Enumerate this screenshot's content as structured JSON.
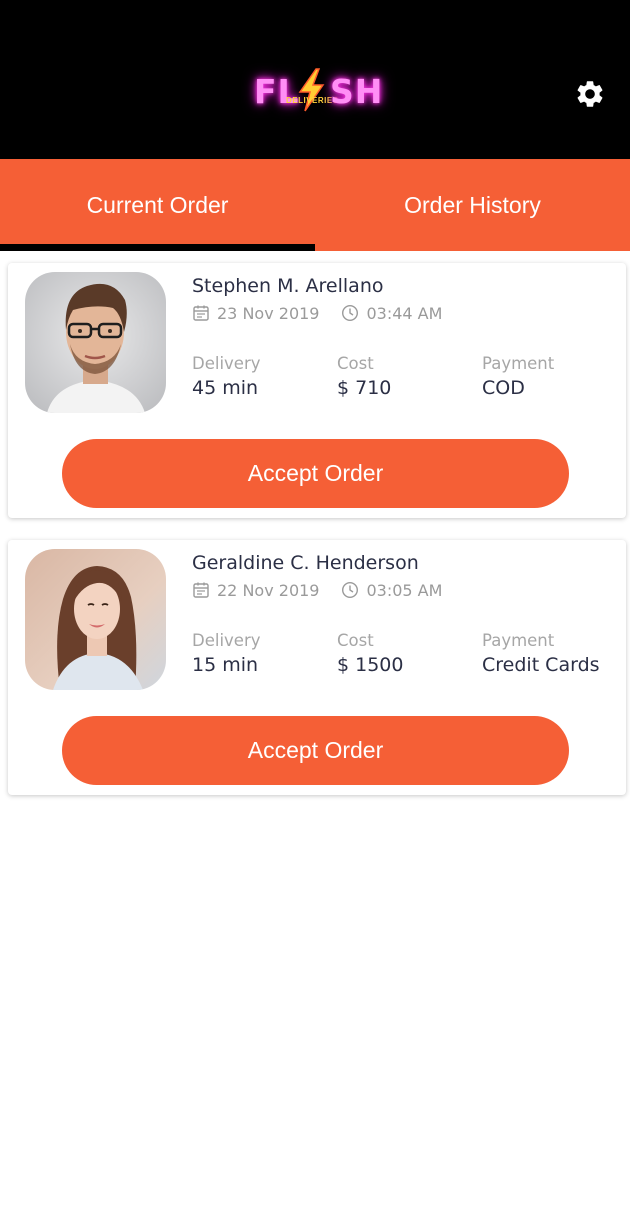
{
  "header": {
    "logo": {
      "text_left": "FL",
      "text_right": "SH",
      "tagline": "DELIVERIES"
    },
    "settings_icon": "gear-icon"
  },
  "tabs": [
    {
      "label": "Current Order",
      "active": true
    },
    {
      "label": "Order History",
      "active": false
    }
  ],
  "orders": [
    {
      "name": "Stephen M. Arellano",
      "date": "23 Nov 2019",
      "time": "03:44 AM",
      "delivery_label": "Delivery",
      "delivery_value": "45 min",
      "cost_label": "Cost",
      "cost_value": "$ 710",
      "payment_label": "Payment",
      "payment_value": "COD",
      "button_label": "Accept Order"
    },
    {
      "name": "Geraldine C. Henderson",
      "date": "22 Nov 2019",
      "time": "03:05 AM",
      "delivery_label": "Delivery",
      "delivery_value": "15 min",
      "cost_label": "Cost",
      "cost_value": "$ 1500",
      "payment_label": "Payment",
      "payment_value": "Credit Cards",
      "button_label": "Accept Order"
    }
  ],
  "colors": {
    "accent": "#f55f36",
    "header_bg": "#000000",
    "text_dark": "#2b2f45",
    "text_muted": "#9a9a9a"
  }
}
